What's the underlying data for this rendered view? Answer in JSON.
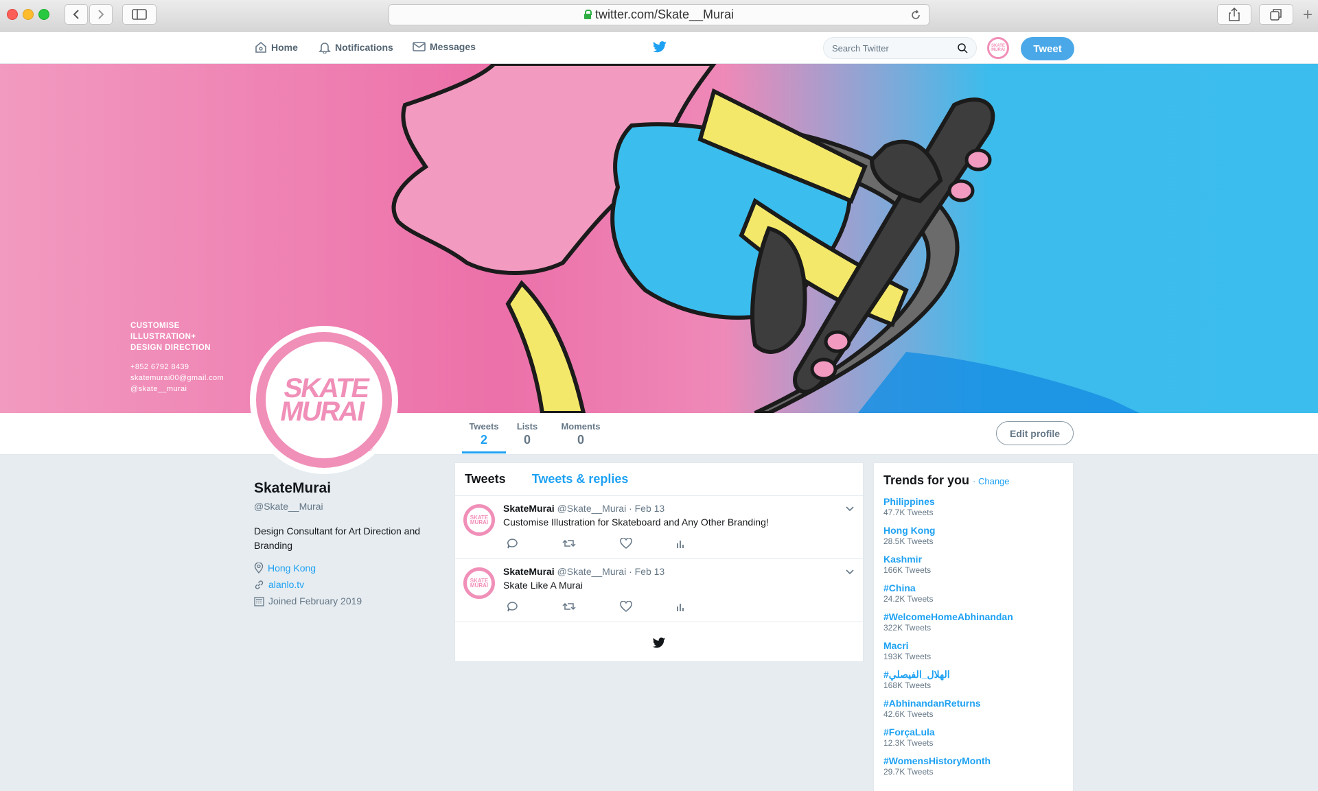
{
  "browser": {
    "url": "twitter.com/Skate__Murai"
  },
  "nav": {
    "home": "Home",
    "notifications": "Notifications",
    "messages": "Messages",
    "search_placeholder": "Search Twitter",
    "tweet_button": "Tweet"
  },
  "banner": {
    "lines_bold": [
      "CUSTOMISE",
      "ILLUSTRATION+",
      "DESIGN DIRECTION"
    ],
    "phone": "+852 6792 8439",
    "email": "skatemurai00@gmail.com",
    "handle": "@skate__murai"
  },
  "logo": {
    "line1": "SKATE",
    "line2": "MURAI",
    "mark": "®"
  },
  "profile": {
    "name": "SkateMurai",
    "handle": "@Skate__Murai",
    "bio": "Design Consultant for Art Direction and Branding",
    "location": "Hong Kong",
    "website": "alanlo.tv",
    "joined": "Joined February 2019"
  },
  "stats": [
    {
      "label": "Tweets",
      "value": "2"
    },
    {
      "label": "Lists",
      "value": "0"
    },
    {
      "label": "Moments",
      "value": "0"
    }
  ],
  "edit_profile": "Edit profile",
  "timeline": {
    "tab_tweets": "Tweets",
    "tab_replies": "Tweets & replies",
    "tweets": [
      {
        "name": "SkateMurai",
        "meta": "@Skate__Murai · Feb 13",
        "text": "Customise Illustration for Skateboard and Any Other Branding!"
      },
      {
        "name": "SkateMurai",
        "meta": "@Skate__Murai · Feb 13",
        "text": "Skate Like A Murai"
      }
    ]
  },
  "trends": {
    "title": "Trends for you",
    "change": "Change",
    "items": [
      {
        "name": "Philippines",
        "count": "47.7K Tweets"
      },
      {
        "name": "Hong Kong",
        "count": "28.5K Tweets"
      },
      {
        "name": "Kashmir",
        "count": "166K Tweets"
      },
      {
        "name": "#China",
        "count": "24.2K Tweets"
      },
      {
        "name": "#WelcomeHomeAbhinandan",
        "count": "322K Tweets"
      },
      {
        "name": "Macri",
        "count": "193K Tweets"
      },
      {
        "name": "#الهلال_الفيصلي",
        "count": "168K Tweets"
      },
      {
        "name": "#AbhinandanReturns",
        "count": "42.6K Tweets"
      },
      {
        "name": "#ForçaLula",
        "count": "12.3K Tweets"
      },
      {
        "name": "#WomensHistoryMonth",
        "count": "29.7K Tweets"
      }
    ]
  },
  "colors": {
    "twitter_blue": "#1da1f2",
    "brand_pink": "#f08fb8",
    "banner_pink": "#ec70a9",
    "banner_blue": "#3bbdee"
  }
}
